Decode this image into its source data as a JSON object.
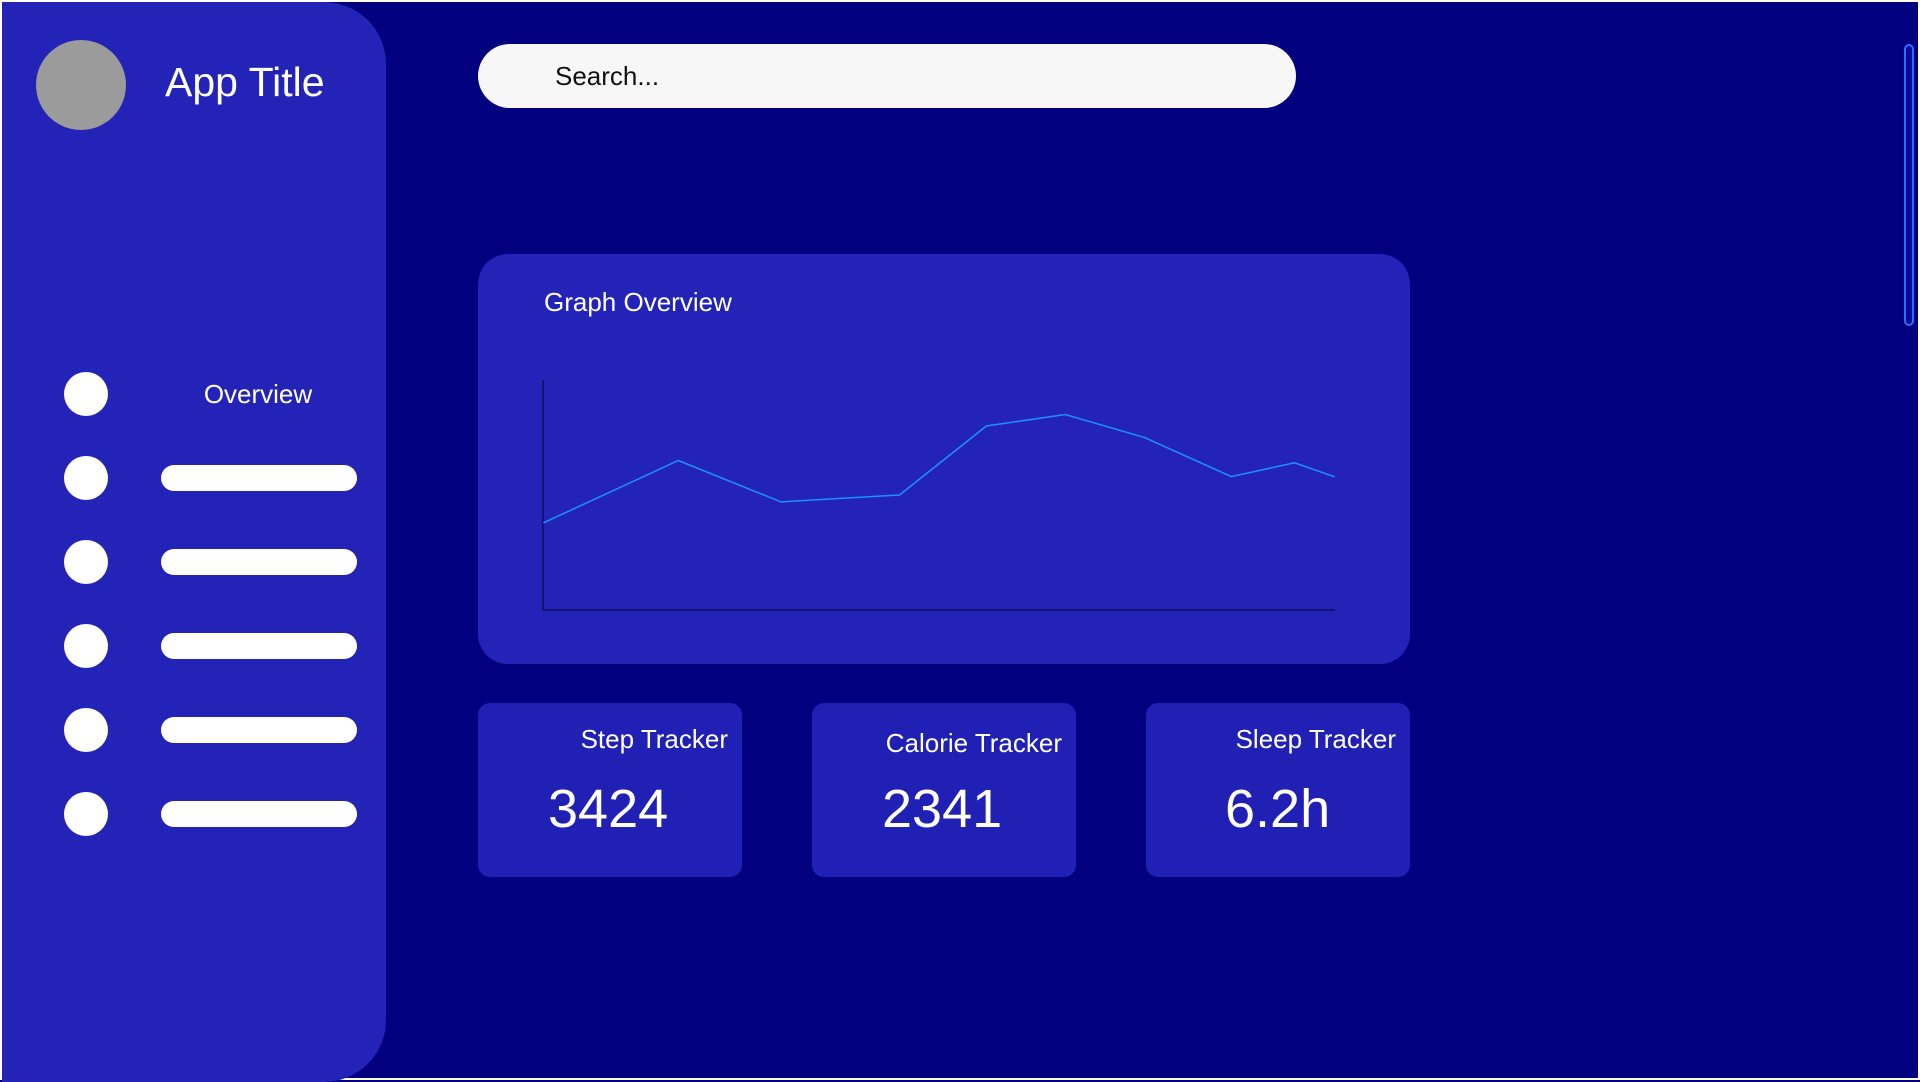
{
  "app": {
    "title": "App Title"
  },
  "sidebar": {
    "items": [
      {
        "label": "Overview"
      },
      {
        "label": ""
      },
      {
        "label": ""
      },
      {
        "label": ""
      },
      {
        "label": ""
      },
      {
        "label": ""
      }
    ]
  },
  "search": {
    "placeholder": "Search..."
  },
  "graph": {
    "title": "Graph Overview"
  },
  "chart_data": {
    "type": "line",
    "title": "Graph Overview",
    "xlabel": "",
    "ylabel": "",
    "grid": false,
    "series": [
      {
        "values": [
          38,
          65,
          47,
          50,
          80,
          85,
          75,
          58,
          64,
          58
        ]
      }
    ],
    "x": [
      0,
      17,
      30,
      45,
      56,
      66,
      76,
      87,
      95,
      100
    ],
    "xlim": [
      0,
      100
    ],
    "ylim": [
      0,
      100
    ],
    "line_color": "#1e90ff"
  },
  "trackers": [
    {
      "label": "Step Tracker",
      "value": "3424"
    },
    {
      "label": "Calorie Tracker",
      "value": "2341"
    },
    {
      "label": "Sleep Tracker",
      "value": "6.2h"
    }
  ],
  "colors": {
    "background": "#02007f",
    "panel": "#2323b7",
    "accent_line": "#1e90ff",
    "avatar": "#9b9b9b"
  }
}
